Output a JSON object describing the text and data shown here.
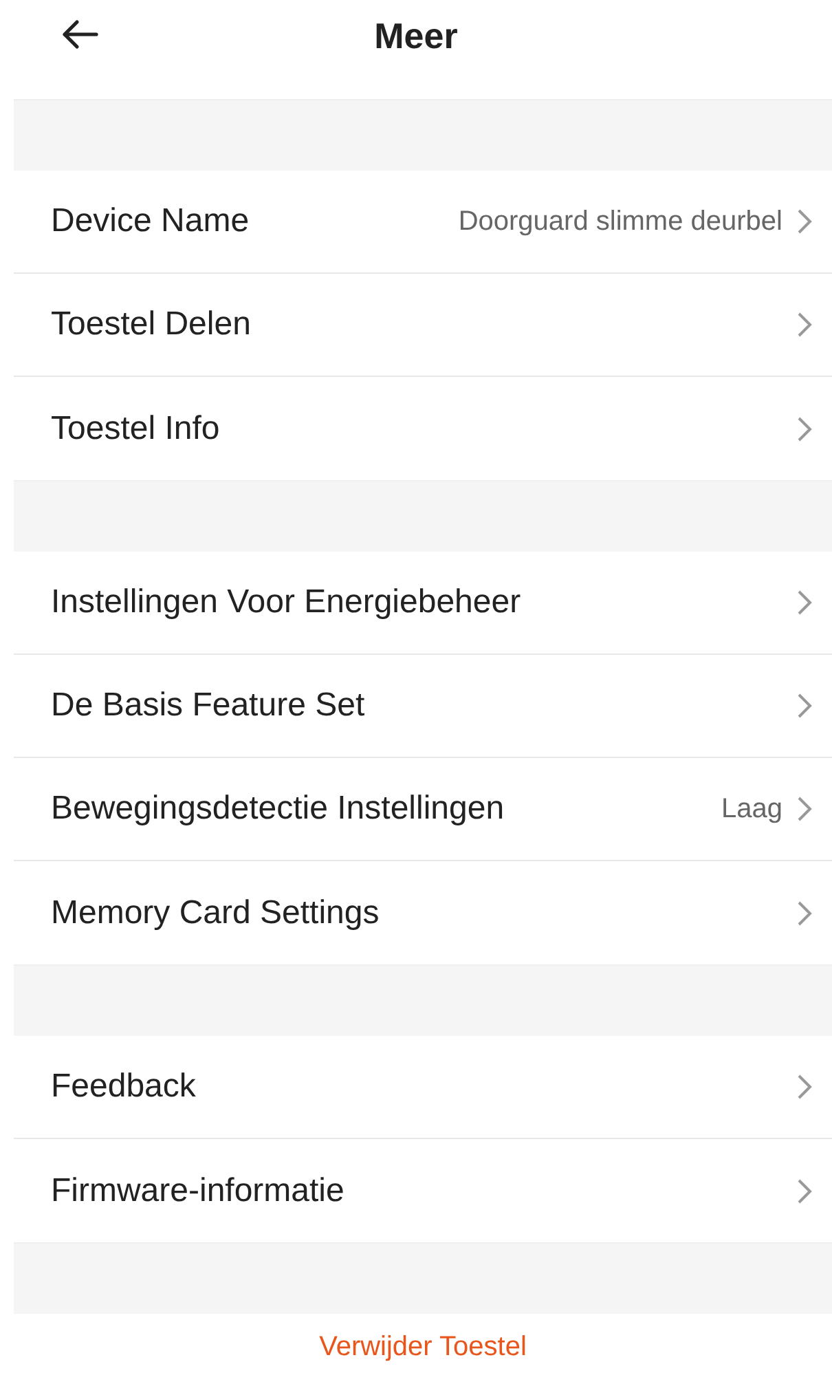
{
  "header": {
    "title": "Meer"
  },
  "sections": [
    {
      "rows": [
        {
          "label": "Device Name",
          "value": "Doorguard slimme deurbel"
        },
        {
          "label": "Toestel Delen"
        },
        {
          "label": "Toestel Info"
        }
      ]
    },
    {
      "rows": [
        {
          "label": "Instellingen Voor Energiebeheer"
        },
        {
          "label": "De Basis Feature Set"
        },
        {
          "label": "Bewegingsdetectie Instellingen",
          "value": "Laag"
        },
        {
          "label": "Memory Card Settings"
        }
      ]
    },
    {
      "rows": [
        {
          "label": "Feedback"
        },
        {
          "label": "Firmware-informatie"
        }
      ]
    }
  ],
  "remove_button": "Verwijder Toestel"
}
